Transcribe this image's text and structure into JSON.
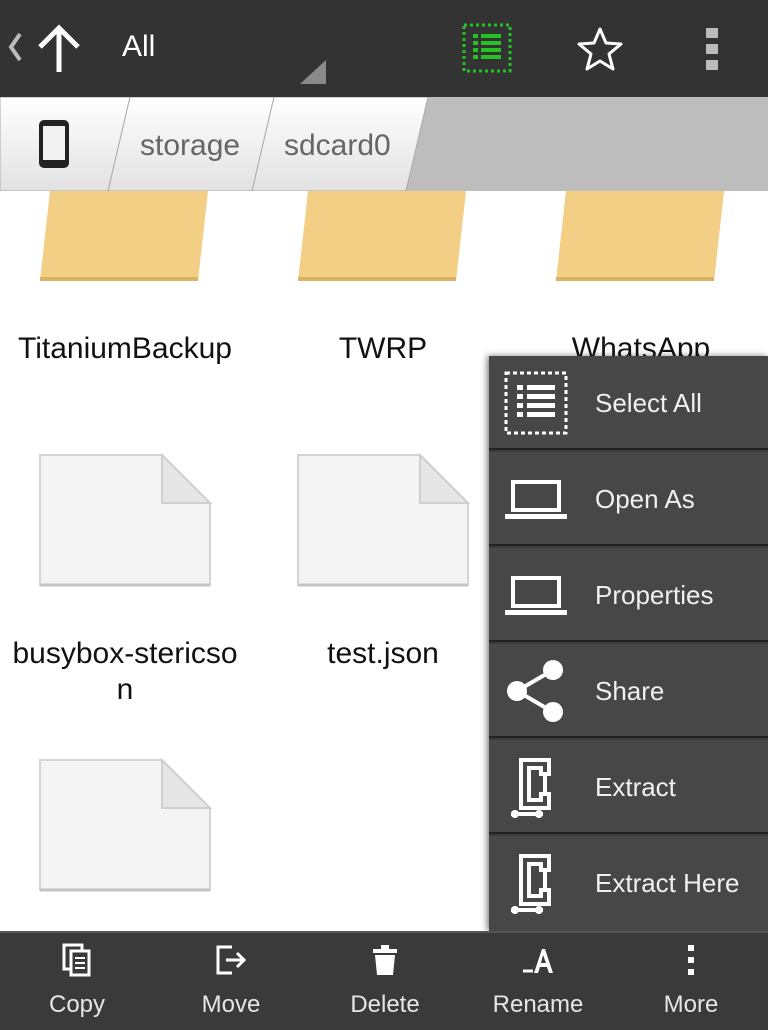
{
  "actionbar": {
    "title": "All",
    "icons": [
      "back-chevron-icon",
      "up-arrow-icon",
      "list-view-icon",
      "star-icon",
      "overflow-menu-icon"
    ],
    "accent": "#22c322"
  },
  "breadcrumb": {
    "items": [
      {
        "label": "",
        "icon": "phone-icon"
      },
      {
        "label": "storage"
      },
      {
        "label": "sdcard0"
      }
    ]
  },
  "files": [
    {
      "name": "",
      "type": "folder"
    },
    {
      "name": "",
      "type": "folder"
    },
    {
      "name": "",
      "type": "folder"
    },
    {
      "name": "TitaniumBackup",
      "type": "folder"
    },
    {
      "name": "TWRP",
      "type": "folder"
    },
    {
      "name": "WhatsApp",
      "type": "folder"
    },
    {
      "name": "busybox-stericson",
      "type": "file"
    },
    {
      "name": "test.json",
      "type": "file"
    },
    {
      "name": "",
      "type": "file"
    }
  ],
  "context_menu": {
    "items": [
      {
        "label": "Select All",
        "icon": "select-all-icon"
      },
      {
        "label": "Open As",
        "icon": "laptop-icon"
      },
      {
        "label": "Properties",
        "icon": "laptop-icon"
      },
      {
        "label": "Share",
        "icon": "share-icon"
      },
      {
        "label": "Extract",
        "icon": "clamp-icon"
      },
      {
        "label": "Extract Here",
        "icon": "clamp-icon"
      }
    ]
  },
  "bottombar": {
    "items": [
      {
        "label": "Copy",
        "icon": "copy-icon"
      },
      {
        "label": "Move",
        "icon": "move-icon"
      },
      {
        "label": "Delete",
        "icon": "trash-icon"
      },
      {
        "label": "Rename",
        "icon": "rename-icon"
      },
      {
        "label": "More",
        "icon": "more-icon"
      }
    ]
  }
}
